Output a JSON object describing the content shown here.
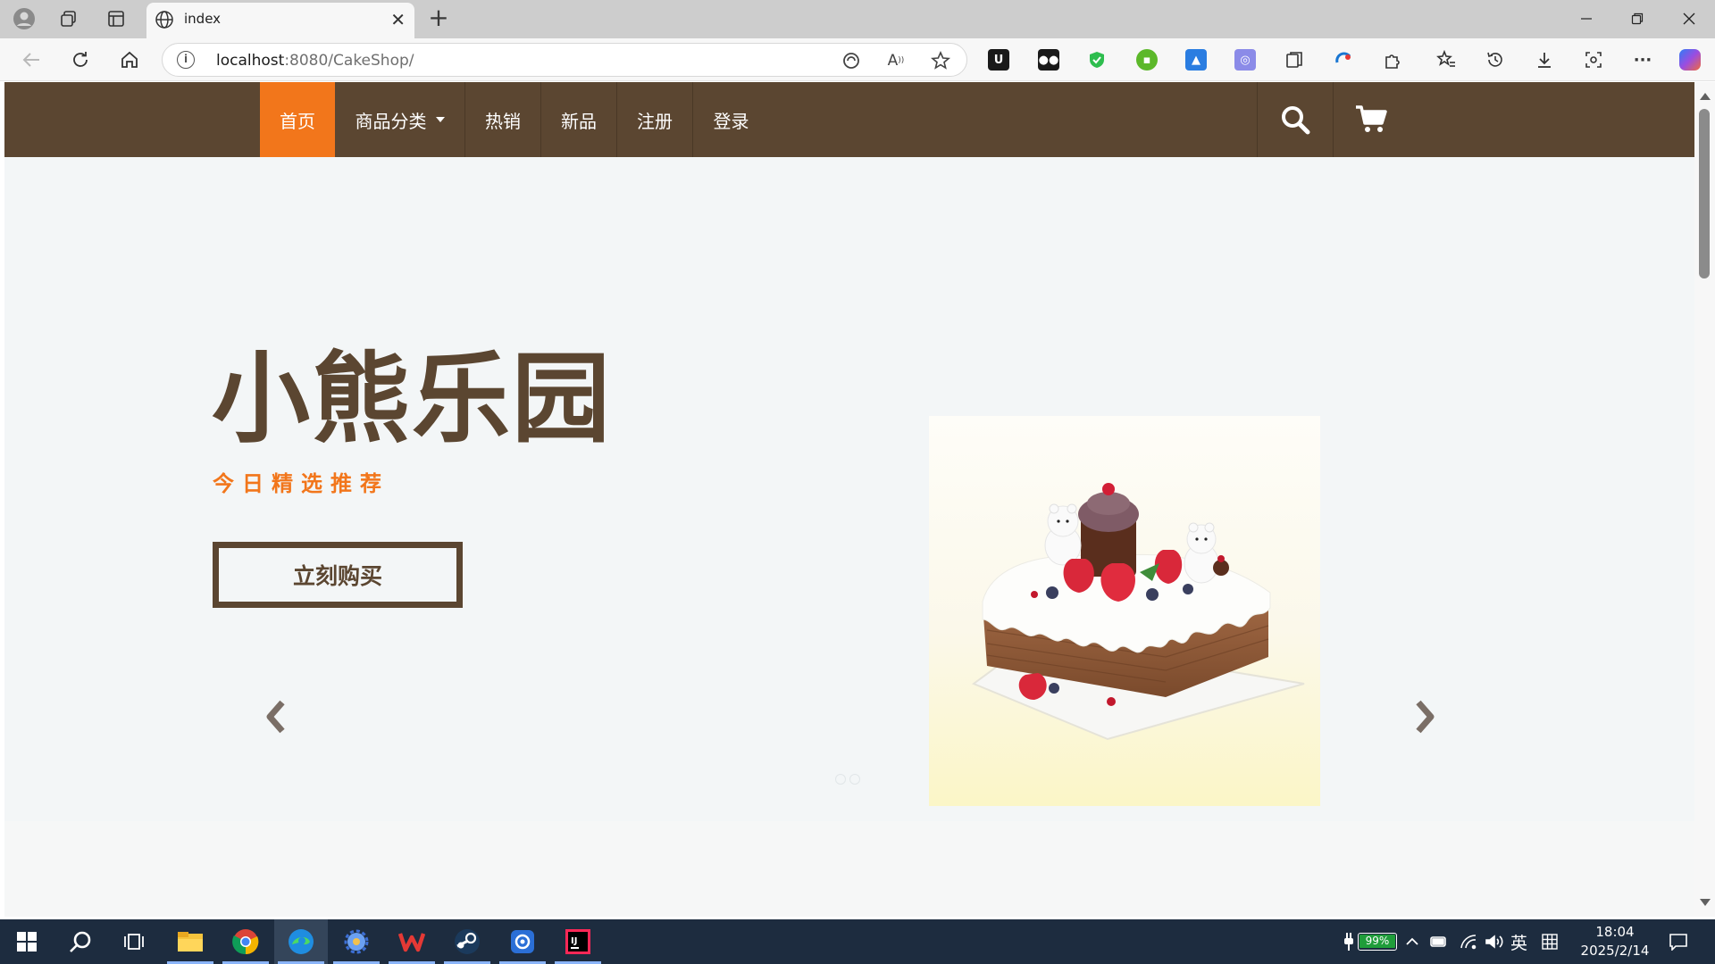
{
  "browser": {
    "tab_title": "index",
    "url_host": "localhost",
    "url_rest": ":8080/CakeShop/"
  },
  "site": {
    "nav": {
      "items": [
        {
          "label": "首页",
          "active": true
        },
        {
          "label": "商品分类",
          "has_dropdown": true
        },
        {
          "label": "热销"
        },
        {
          "label": "新品"
        },
        {
          "label": "注册"
        },
        {
          "label": "登录"
        }
      ],
      "search_icon": "search-icon",
      "cart_icon": "cart-icon"
    },
    "hero": {
      "title": "小熊乐园",
      "subtitle": "今日精选推荐",
      "cta_label": "立刻购买"
    }
  },
  "colors": {
    "nav_bg": "#5b4631",
    "accent": "#f2761b",
    "page_bg": "#f3f6f7",
    "taskbar_bg": "#1d2c3f"
  },
  "taskbar": {
    "battery": "99%",
    "ime": "英",
    "time": "18:04",
    "date": "2025/2/14"
  }
}
